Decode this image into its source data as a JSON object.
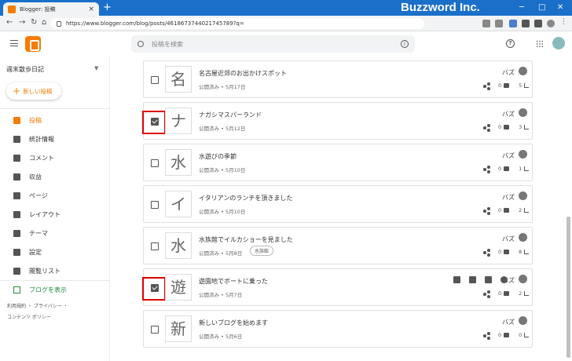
{
  "browser": {
    "tab_title": "Blogger: 投稿",
    "tab_close": "×",
    "new_tab": "+",
    "url": "https://www.blogger.com/blog/posts/4618673744021745789?q=",
    "brand_overlay": "Buzzword Inc."
  },
  "header": {
    "search_placeholder": "投稿を検索",
    "help": "?"
  },
  "sidebar": {
    "blog_name": "週末散歩日記",
    "new_post": "新しい投稿",
    "items": [
      {
        "label": "投稿",
        "icon": "posts-icon",
        "active": true
      },
      {
        "label": "統計情報",
        "icon": "stats-icon"
      },
      {
        "label": "コメント",
        "icon": "comments-icon"
      },
      {
        "label": "収益",
        "icon": "earnings-icon"
      },
      {
        "label": "ページ",
        "icon": "pages-icon"
      },
      {
        "label": "レイアウト",
        "icon": "layout-icon"
      },
      {
        "label": "テーマ",
        "icon": "theme-icon"
      },
      {
        "label": "設定",
        "icon": "settings-icon"
      },
      {
        "label": "閲覧リスト",
        "icon": "reading-list-icon"
      }
    ],
    "view_blog": "ブログを表示",
    "footer_line1": "利用規約 ・ プライバシー ・",
    "footer_line2": "コンテンツ ポリシー"
  },
  "posts": [
    {
      "thumb": "名",
      "title": "名古屋近郊のお出かけスポット",
      "meta": "公開済み • 5月17日",
      "author": "バズ",
      "comments": "0",
      "views": "5",
      "checked": false
    },
    {
      "thumb": "ナ",
      "title": "ナガシマスパーランド",
      "meta": "公開済み • 5月12日",
      "author": "バズ",
      "comments": "0",
      "views": "3",
      "checked": true
    },
    {
      "thumb": "水",
      "title": "水遊びの季節",
      "meta": "公開済み • 5月10日",
      "author": "バズ",
      "comments": "0",
      "views": "1",
      "checked": false
    },
    {
      "thumb": "イ",
      "title": "イタリアンのランチを頂きました",
      "meta": "公開済み • 5月10日",
      "author": "バズ",
      "comments": "0",
      "views": "2",
      "checked": false
    },
    {
      "thumb": "水",
      "title": "水族館でイルカショーを見ました",
      "meta": "公開済み • 5月8日",
      "label": "水族館",
      "author": "バズ",
      "comments": "0",
      "views": "8",
      "checked": false
    },
    {
      "thumb": "遊",
      "title": "遊園地でボートに乗った",
      "meta": "公開済み • 5月7日",
      "author": "バズ",
      "comments": "0",
      "views": "2",
      "checked": true
    },
    {
      "thumb": "新",
      "title": "新しいブログを始めます",
      "meta": "公開済み • 5月6日",
      "author": "バズ",
      "comments": "0",
      "views": "0",
      "checked": false
    }
  ],
  "colors": {
    "accent": "#f57c00",
    "highlight": "#dd0000",
    "chrome_blue": "#1a6fc9",
    "link_green": "#1e8e3e"
  }
}
